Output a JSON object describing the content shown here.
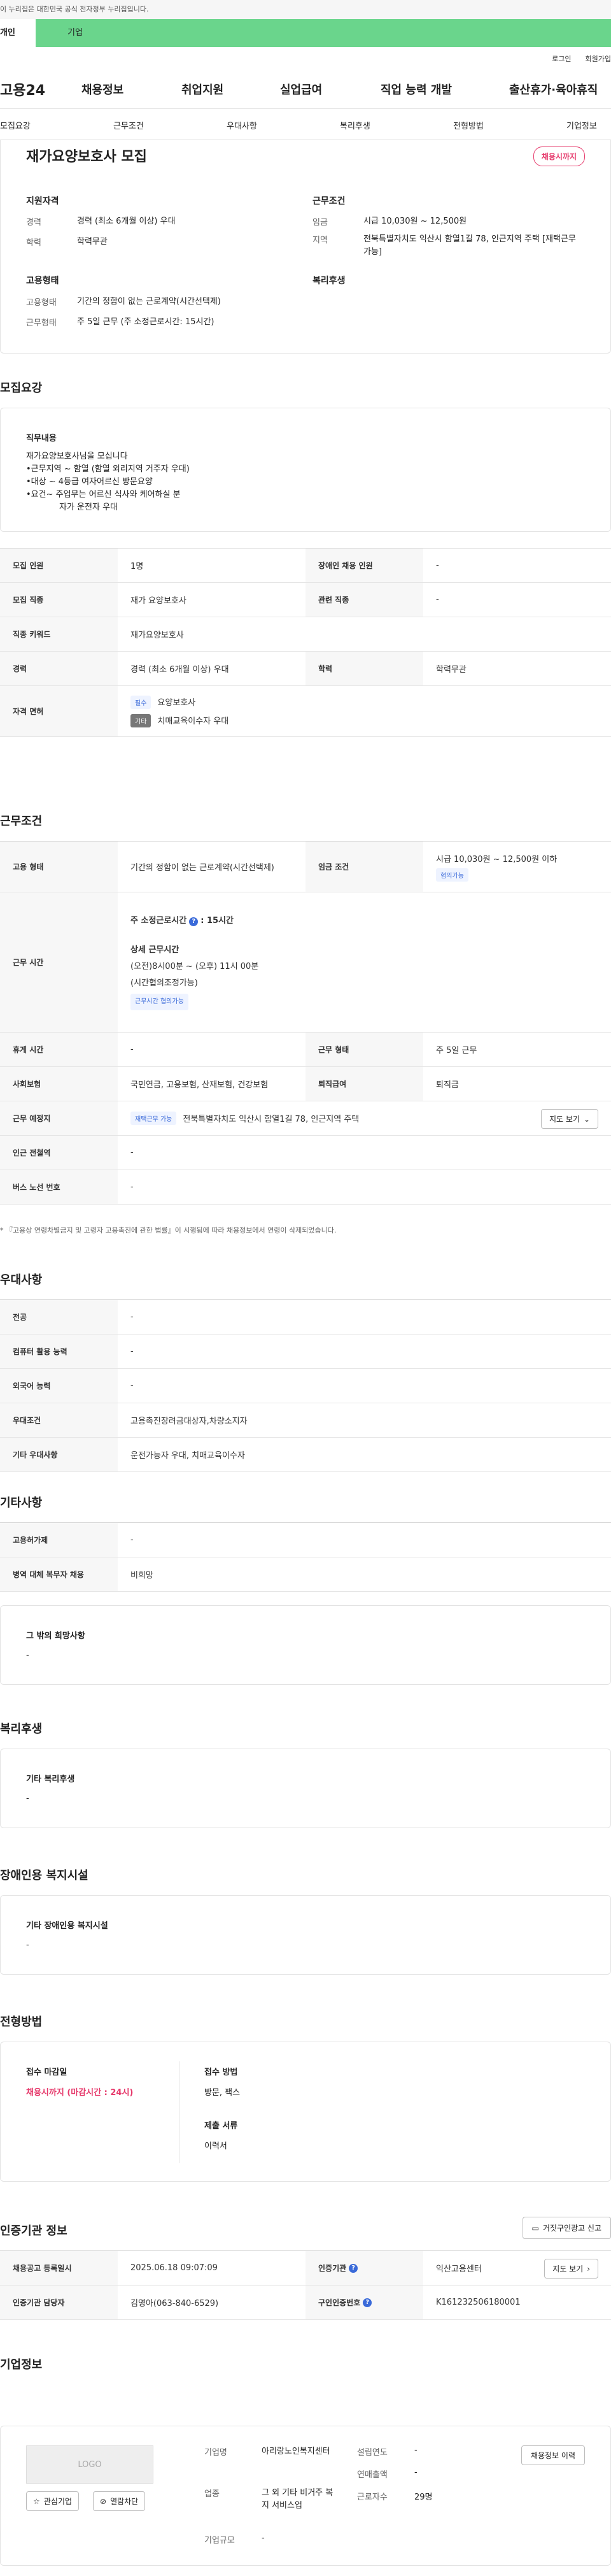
{
  "gov_banner": "이 누리집은 대한민국 공식 전자정부 누리집입니다.",
  "top_tabs": {
    "personal": "개인",
    "corp": "기업"
  },
  "util": {
    "login": "로그인",
    "join": "회원가입"
  },
  "gnb": {
    "logo": "고용24",
    "items": [
      "채용정보",
      "취업지원",
      "실업급여",
      "직업 능력 개발",
      "출산휴가·육아휴직"
    ]
  },
  "subnav": [
    "모집요강",
    "근무조건",
    "우대사항",
    "복리후생",
    "전형방법",
    "기업정보"
  ],
  "summary": {
    "title": "재가요양보호사 모집",
    "badge": "채용시까지",
    "qual_title": "지원자격",
    "cond_title": "근무조건",
    "emp_title": "고용형태",
    "welfare_title": "복리후생",
    "career_k": "경력",
    "career_v": "경력 (최소 6개월 이상) 우대",
    "edu_k": "학력",
    "edu_v": "학력무관",
    "wage_k": "임금",
    "wage_v": "시급 10,030원 ~ 12,500원",
    "region_k": "지역",
    "region_v": "전북특별자치도 익산시 함열1길 78, 인근지역 주택 [재택근무 가능]",
    "emptype_k": "고용형태",
    "emptype_v": "기간의 정함이 없는 근로계약(시간선택제)",
    "worktype_k": "근무형태",
    "worktype_v": "주 5일 근무 (주 소정근로시간: 15시간)"
  },
  "recruit": {
    "heading": "모집요강",
    "duty_title": "직무내용",
    "duty_lines": [
      "재가요양보호사님을 모십니다",
      "•근무지역 ~ 함열 (함열 외리지역 거주자 우대)",
      "•대상 ~ 4등급 여자어르신 방문요양",
      "•요건~ 주업무는 어르신 식사와 케어하실 분",
      "자가 운전자 우대"
    ],
    "rows": {
      "count_k": "모집 인원",
      "count_v": "1명",
      "dis_k": "장애인 채용 인원",
      "dis_v": "-",
      "job_k": "모집 직종",
      "job_v": "재가 요양보호사",
      "rel_k": "관련 직종",
      "rel_v": "-",
      "kw_k": "직종 키워드",
      "kw_v": "재가요양보호사",
      "career_k": "경력",
      "career_v": "경력 (최소 6개월 이상) 우대",
      "edu_k": "학력",
      "edu_v": "학력무관",
      "lic_k": "자격 면허",
      "lic_chip1": "필수",
      "lic_v1": "요양보호사",
      "lic_chip2": "기타",
      "lic_v2": "치매교육이수자 우대"
    }
  },
  "work": {
    "heading": "근무조건",
    "emp_k": "고용 형태",
    "emp_v": "기간의 정함이 없는 근로계약(시간선택제)",
    "wage_k": "임금 조건",
    "wage_v": "시급 10,030원 ~ 12,500원 이하",
    "wage_chip": "협의가능",
    "time_k": "근무 시간",
    "time_week": "주 소정근로시간",
    "time_week_v": ": 15시간",
    "time_detail_t": "상세 근무시간",
    "time_detail_1": "(오전)8시00분 ~ (오후) 11시 00분",
    "time_detail_2": "(시간협의조정가능)",
    "time_chip": "근무시간 협의가능",
    "rest_k": "휴게 시간",
    "rest_v": "-",
    "form_k": "근무 형태",
    "form_v": "주 5일 근무",
    "ins_k": "사회보험",
    "ins_v": "국민연금, 고용보험, 산재보험, 건강보험",
    "ret_k": "퇴직급여",
    "ret_v": "퇴직금",
    "loc_k": "근무 예정지",
    "loc_chip": "재택근무 가능",
    "loc_v": "전북특별자치도 익산시 함열1길 78, 인근지역 주택",
    "map_btn": "지도 보기",
    "sub_k": "인근 전철역",
    "sub_v": "-",
    "bus_k": "버스 노선 번호",
    "bus_v": "-",
    "note": "* 『고용상 연령차별금지 및 고령자 고용촉진에 관한 법률』이 시행됨에 따라 채용정보에서 연령이 삭제되었습니다."
  },
  "pref": {
    "heading": "우대사항",
    "major_k": "전공",
    "major_v": "-",
    "pc_k": "컴퓨터 활용 능력",
    "pc_v": "-",
    "lang_k": "외국어 능력",
    "lang_v": "-",
    "cond_k": "우대조건",
    "cond_v": "고용촉진장려금대상자,차량소지자",
    "etc_k": "기타 우대사항",
    "etc_v": "운전가능자 우대, 치매교육이수자"
  },
  "other": {
    "heading": "기타사항",
    "permit_k": "고용허가제",
    "permit_v": "-",
    "army_k": "병역 대체 복무자 채용",
    "army_v": "비희망",
    "hope_t": "그 밖의 희망사항",
    "hope_v": "-"
  },
  "welfare": {
    "heading": "복리후생",
    "t": "기타 복리후생",
    "v": "-"
  },
  "disab": {
    "heading": "장애인용 복지시설",
    "t": "기타 장애인용 복지시설",
    "v": "-"
  },
  "screen": {
    "heading": "전형방법",
    "deadline_t": "접수 마감일",
    "deadline_v": "채용시까지 (마감시간 : 24시)",
    "method_t": "접수 방법",
    "method_v": "방문, 팩스",
    "docs_t": "제출 서류",
    "docs_v": "이력서"
  },
  "agency": {
    "heading": "인증기관 정보",
    "report_btn": "거짓구인광고 신고",
    "date_k": "채용공고 등록일시",
    "date_v": "2025.06.18 09:07:09",
    "org_k": "인증기관",
    "org_v": "익산고용센터",
    "map_btn": "지도 보기",
    "mgr_k": "인증기관 담당자",
    "mgr_v": "김영아(063-840-6529)",
    "num_k": "구인인증번호",
    "num_v": "K161232506180001"
  },
  "company": {
    "heading": "기업정보",
    "logo": "LOGO",
    "fav_btn": "관심기업",
    "block_btn": "열람차단",
    "hist_btn": "채용정보 이력",
    "name_k": "기업명",
    "name_v": "아리랑노인복지센터",
    "est_k": "설립연도",
    "est_v": "-",
    "sales_k": "연매출액",
    "sales_v": "-",
    "ind_k": "업종",
    "ind_v": "그 외 기타 비거주 복지 서비스업",
    "emp_k": "근로자수",
    "emp_v": "29명",
    "size_k": "기업규모",
    "size_v": "-"
  }
}
